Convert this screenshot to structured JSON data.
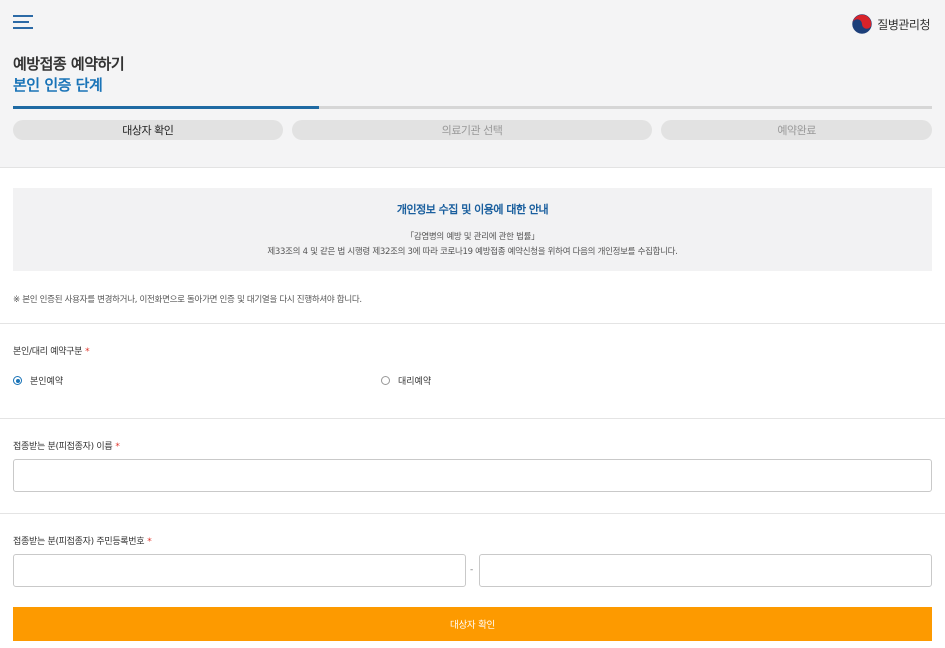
{
  "header": {
    "menu_icon": "hamburger-menu-icon",
    "logo_icon": "taegeuk-emblem-icon",
    "logo_text": "질병관리청",
    "title": "예방접종 예약하기",
    "subtitle": "본인 인증 단계",
    "progress_fraction": 0.333
  },
  "steps": [
    {
      "label": "대상자 확인",
      "active": true
    },
    {
      "label": "의료기관 선택",
      "active": false
    },
    {
      "label": "예약완료",
      "active": false
    }
  ],
  "notice": {
    "title": "개인정보 수집 및 이용에 대한 안내",
    "line1": "「감염병의 예방 및 관리에 관한 법률」",
    "line2": "제33조의 4 및 같은 법 시행령 제32조의 3에 따라 코로나19 예방접종 예약신청을 위하여 다음의 개인정보를 수집합니다."
  },
  "caution": "※ 본인 인증된 사용자를 변경하거나, 이전화면으로 돌아가면 인증 및 대기열을 다시 진행하셔야 합니다.",
  "form": {
    "reservation_type_label": "본인/대리 예약구분",
    "required_mark": "*",
    "options": [
      {
        "label": "본인예약",
        "checked": true
      },
      {
        "label": "대리예약",
        "checked": false
      }
    ],
    "name_label": "접종받는 분(피접종자) 이름",
    "name_value": "",
    "rrn_label": "접종받는 분(피접종자) 주민등록번호",
    "rrn_front_value": "",
    "rrn_separator": "-",
    "rrn_back_value": ""
  },
  "submit_label": "대상자 확인",
  "colors": {
    "accent_blue": "#1a74b8",
    "submit_orange": "#fd9a00",
    "required_red": "#e0352b"
  }
}
